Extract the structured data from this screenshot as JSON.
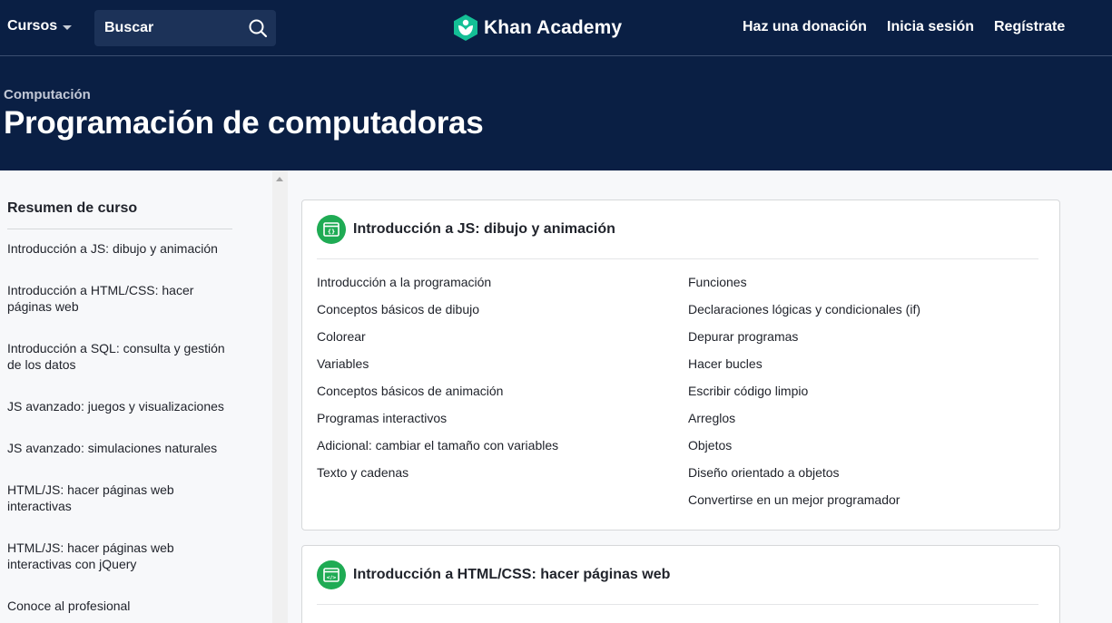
{
  "nav": {
    "courses_label": "Cursos",
    "search_placeholder": "Buscar",
    "logo_text": "Khan Academy",
    "donate_label": "Haz una donación",
    "login_label": "Inicia sesión",
    "signup_label": "Regístrate"
  },
  "header": {
    "breadcrumb": "Computación",
    "title": "Programación de computadoras"
  },
  "sidebar": {
    "title": "Resumen de curso",
    "items": [
      {
        "label": "Introducción a JS: dibujo y animación"
      },
      {
        "label": "Introducción a HTML/CSS: hacer páginas web"
      },
      {
        "label": "Introducción a SQL: consulta y gestión de los datos"
      },
      {
        "label": "JS avanzado: juegos y visualizaciones"
      },
      {
        "label": "JS avanzado: simulaciones naturales"
      },
      {
        "label": "HTML/JS: hacer páginas web interactivas"
      },
      {
        "label": "HTML/JS: hacer páginas web interactivas con jQuery"
      },
      {
        "label": "Conoce al profesional"
      }
    ]
  },
  "units": [
    {
      "title": "Introducción a JS: dibujo y animación",
      "icon": "js-window-icon",
      "left_lessons": [
        "Introducción a la programación",
        "Conceptos básicos de dibujo",
        "Colorear",
        "Variables",
        "Conceptos básicos de animación",
        "Programas interactivos",
        "Adicional: cambiar el tamaño con variables",
        "Texto y cadenas"
      ],
      "right_lessons": [
        "Funciones",
        "Declaraciones lógicas y condicionales (if)",
        "Depurar programas",
        "Hacer bucles",
        "Escribir código limpio",
        "Arreglos",
        "Objetos",
        "Diseño orientado a objetos",
        "Convertirse en un mejor programador"
      ]
    },
    {
      "title": "Introducción a HTML/CSS: hacer páginas web",
      "icon": "html-window-icon"
    }
  ],
  "colors": {
    "nav_bg": "#0a1f44",
    "accent_green": "#1fab54",
    "page_bg": "#f7f8fa"
  }
}
